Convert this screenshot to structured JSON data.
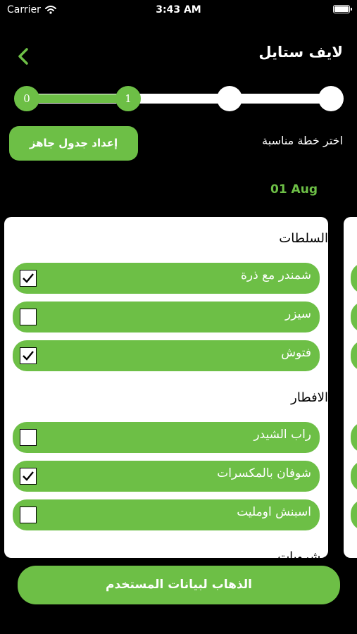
{
  "status_bar": {
    "carrier": "Carrier",
    "time": "3:43 AM"
  },
  "header": {
    "title": "لايف ستايل",
    "back_icon": "chevron-left-icon"
  },
  "stepper": {
    "steps": [
      "0",
      "1",
      "",
      ""
    ],
    "current_step": 1,
    "total_steps": 4
  },
  "plan": {
    "label": "اختر خطة مناسبة",
    "ready_button": "إعداد جدول جاهز"
  },
  "date": "01 Aug",
  "sections": [
    {
      "title": "السلطات",
      "items": [
        {
          "name": "شمندر مع ذرة",
          "checked": true
        },
        {
          "name": "سيزر",
          "checked": false
        },
        {
          "name": "فتوش",
          "checked": true
        }
      ]
    },
    {
      "title": "الافطار",
      "items": [
        {
          "name": "راب الشيدر",
          "checked": false
        },
        {
          "name": "شوفان بالمكسرات",
          "checked": true
        },
        {
          "name": "اسبنش اومليت",
          "checked": false
        }
      ]
    },
    {
      "title": "مشروبات"
    }
  ],
  "footer": {
    "button": "الذهاب لبيانات المستخدم"
  },
  "colors": {
    "accent": "#6dbf46",
    "background": "#000000",
    "card": "#ffffff"
  }
}
